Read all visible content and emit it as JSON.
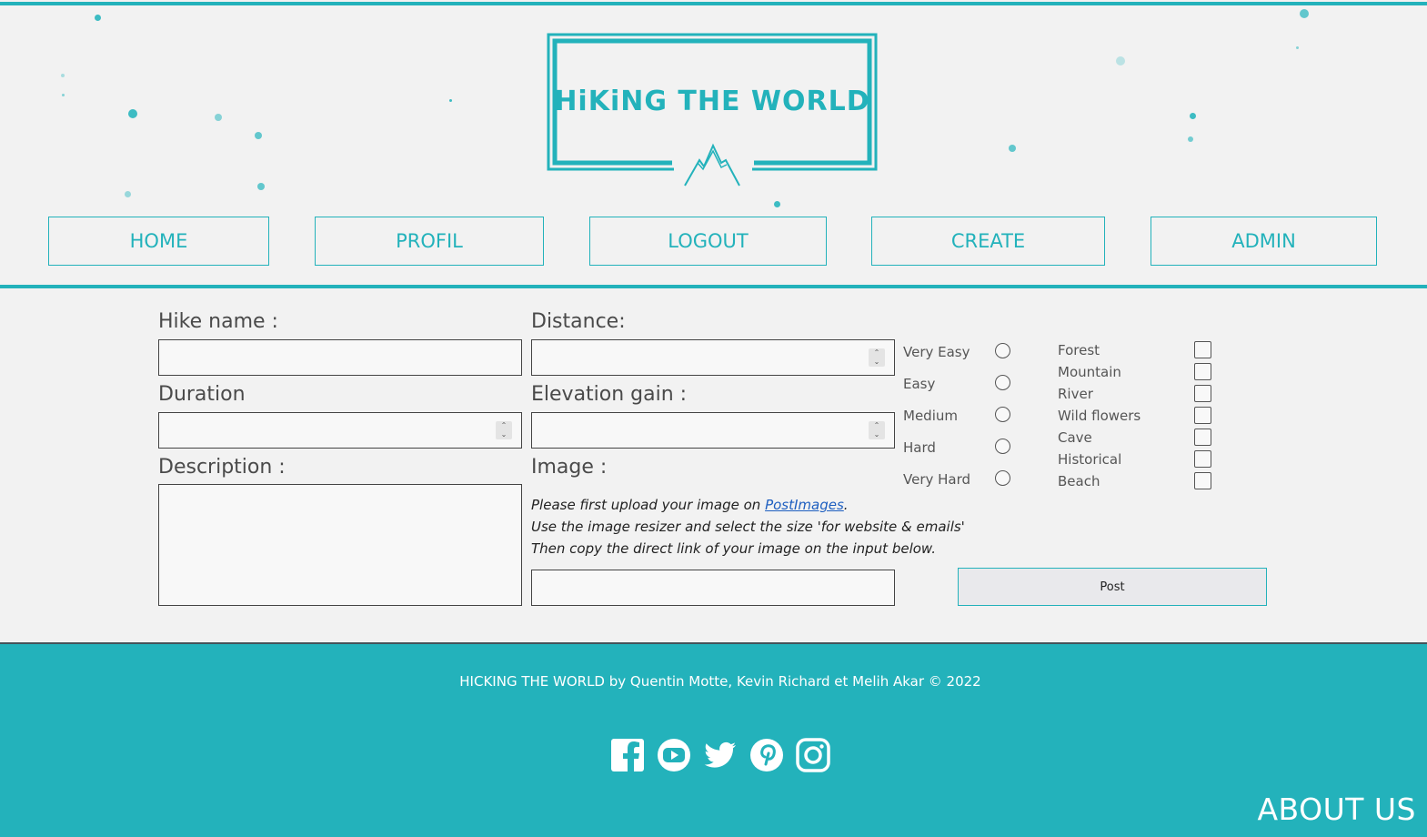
{
  "brand": {
    "logo_text": "HiKiNG THE WORLD",
    "accent": "#23b2bb"
  },
  "nav": [
    {
      "label": "HOME"
    },
    {
      "label": "PROFIL"
    },
    {
      "label": "LOGOUT"
    },
    {
      "label": "CREATE"
    },
    {
      "label": "ADMIN"
    }
  ],
  "form": {
    "hike_name_label": "Hike name :",
    "distance_label": "Distance:",
    "duration_label": "Duration",
    "elevation_label": "Elevation gain :",
    "description_label": "Description :",
    "image_label": "Image :",
    "image_hint_1_prefix": "Please first upload your image on ",
    "image_hint_1_link": "PostImages",
    "image_hint_1_suffix": ".",
    "image_hint_2": "Use the image resizer and select the size 'for website & emails'",
    "image_hint_3": "Then copy the direct link of your image on the input below.",
    "difficulty": [
      "Very Easy",
      "Easy",
      "Medium",
      "Hard",
      "Very Hard"
    ],
    "tags": [
      "Forest",
      "Mountain",
      "River",
      "Wild flowers",
      "Cave",
      "Historical",
      "Beach"
    ],
    "post_label": "Post"
  },
  "footer": {
    "credit": "HICKING THE WORLD by Quentin Motte, Kevin Richard et Melih Akar © 2022",
    "social_icons": [
      "facebook-icon",
      "youtube-icon",
      "twitter-icon",
      "pinterest-icon",
      "instagram-icon"
    ],
    "about_label": "ABOUT US"
  }
}
